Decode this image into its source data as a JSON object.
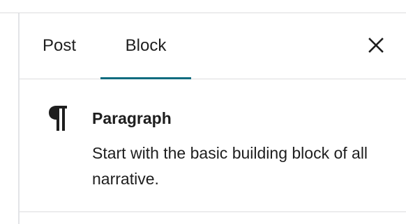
{
  "tabs": [
    {
      "label": "Post",
      "active": false
    },
    {
      "label": "Block",
      "active": true
    }
  ],
  "close_icon": "close-icon",
  "block": {
    "icon": "paragraph-icon",
    "title": "Paragraph",
    "description": "Start with the basic building block of all narrative."
  },
  "colors": {
    "accent": "#0b6b7f",
    "text": "#1e1e1e",
    "border": "#dcdcde"
  }
}
